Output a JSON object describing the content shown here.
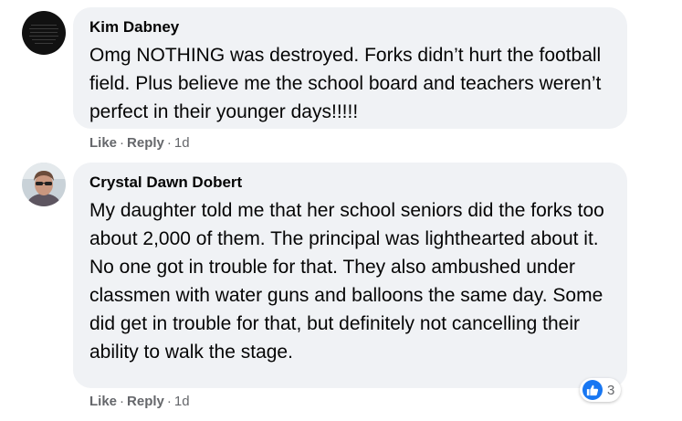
{
  "comments": [
    {
      "author": "Kim Dabney",
      "text": "Omg NOTHING was destroyed. Forks didn’t hurt the football field. Plus believe me the school board and teachers weren’t perfect in their younger days!!!!!",
      "like_label": "Like",
      "reply_label": "Reply",
      "separator": "·",
      "time": "1d"
    },
    {
      "author": "Crystal Dawn Dobert",
      "text": "My daughter told me that her school seniors did the forks too about 2,000 of them. The principal was lighthearted about it. No one got in trouble for that. They also ambushed under classmen with water guns and balloons the same day. Some did get in trouble for that, but definitely not cancelling their ability to walk the stage.",
      "like_label": "Like",
      "reply_label": "Reply",
      "separator": "·",
      "time": "1d",
      "reaction_count": "3",
      "reaction_icon": "thumbs-up-icon"
    }
  ],
  "colors": {
    "bubble": "#f0f2f5",
    "meta": "#65676b",
    "like_blue": "#1877f2"
  }
}
